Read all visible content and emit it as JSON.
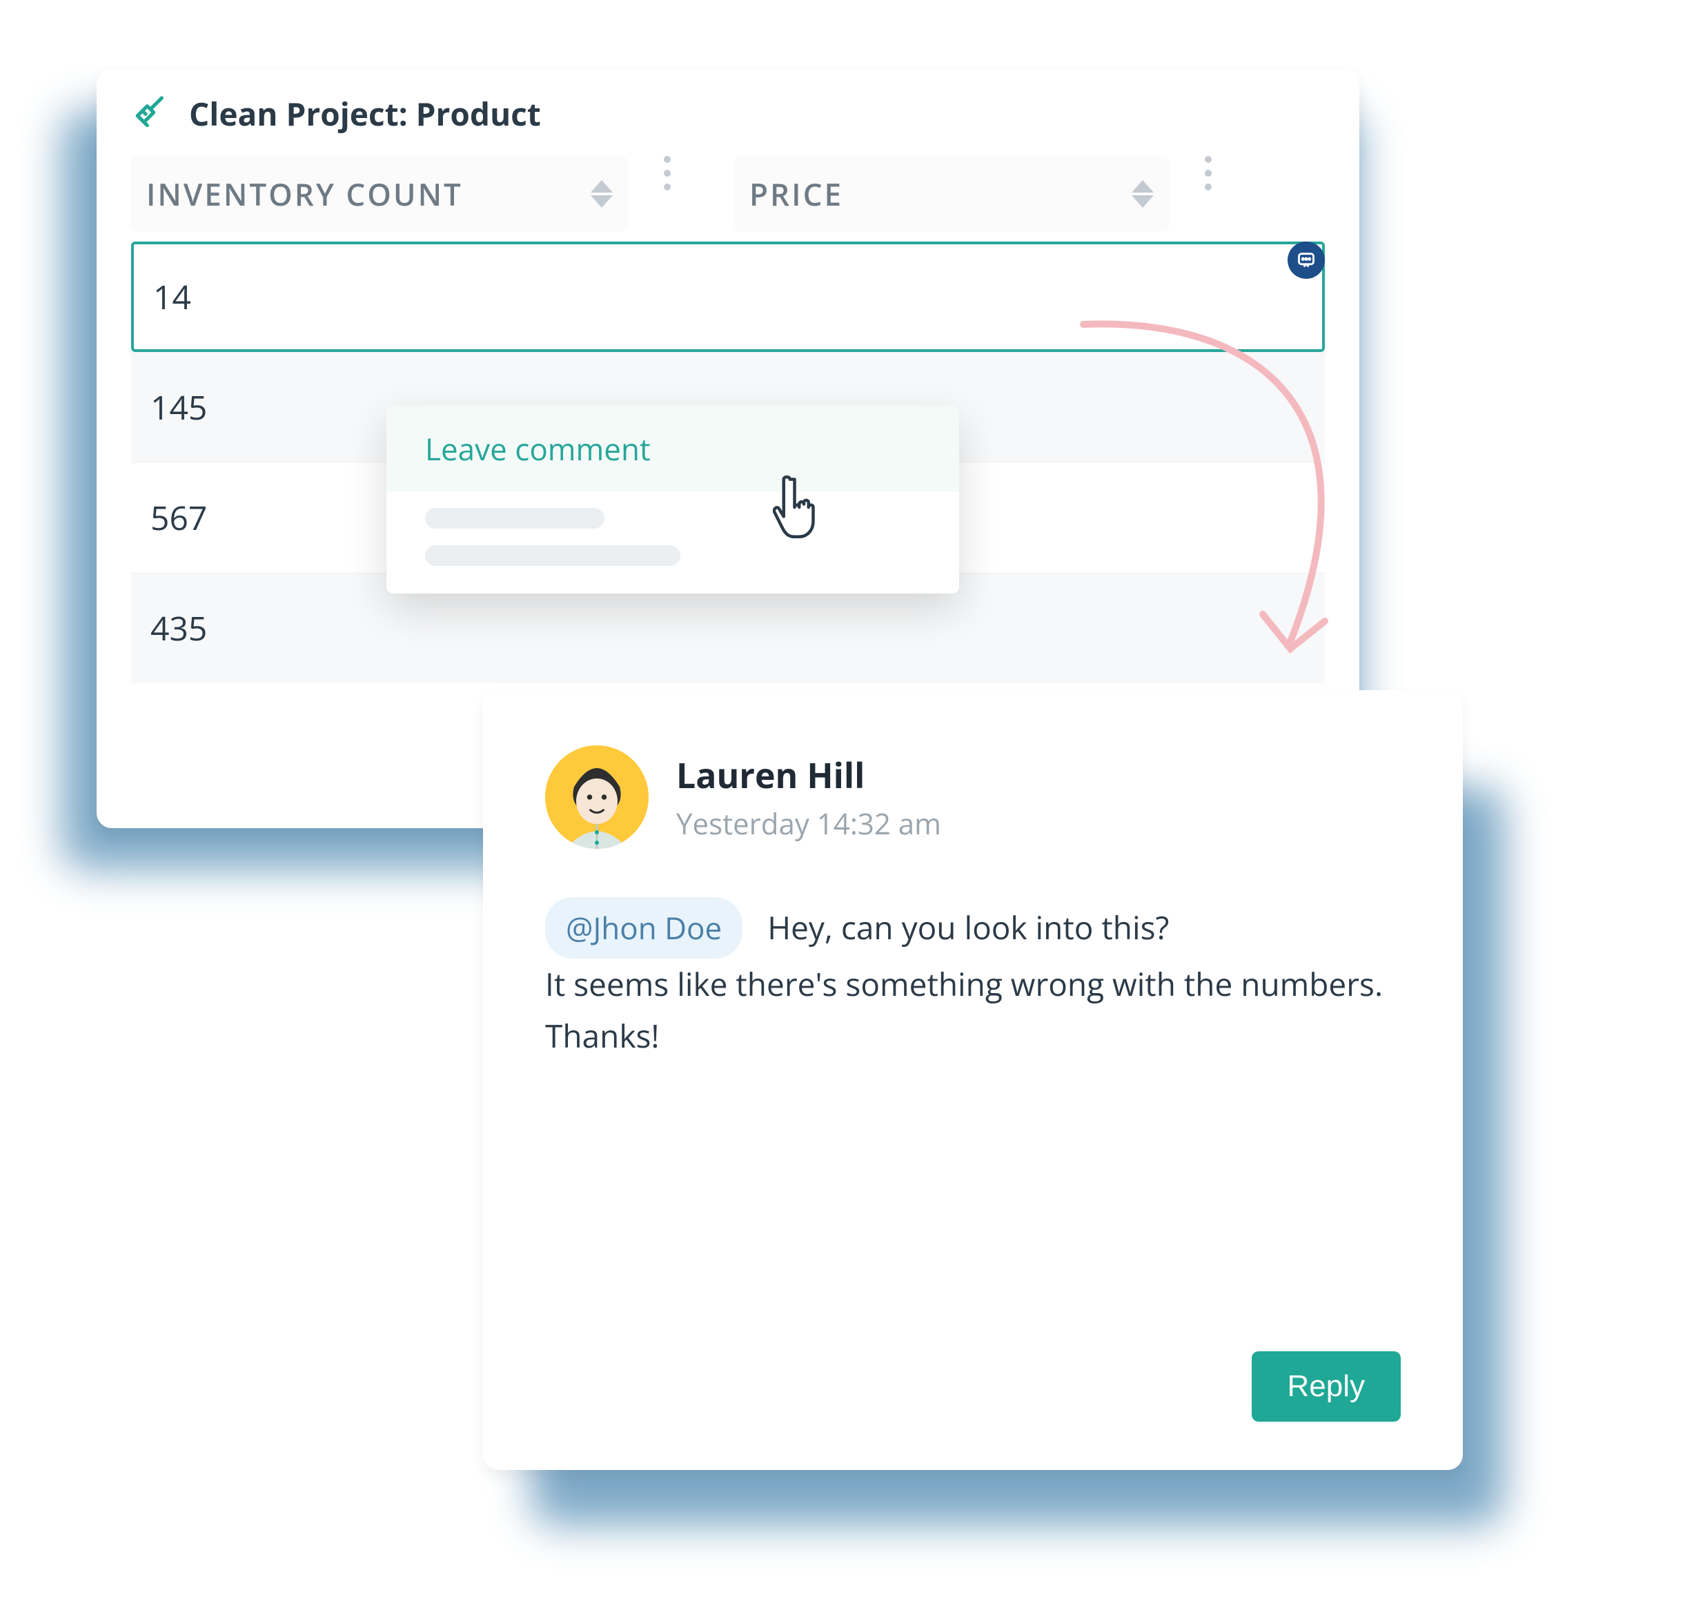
{
  "top": {
    "title": "Clean Project: Product",
    "columns": [
      {
        "label": "INVENTORY COUNT"
      },
      {
        "label": "PRICE"
      }
    ],
    "rows": [
      "14",
      "145",
      "567",
      "435"
    ]
  },
  "context_menu": {
    "leave_comment": "Leave comment"
  },
  "comment": {
    "author": "Lauren Hill",
    "timestamp": "Yesterday 14:32 am",
    "mention": "@Jhon Doe",
    "text_line1": "Hey, can you look into this?",
    "text_line2": "It seems like there's something wrong with the numbers.",
    "text_line3": "Thanks!",
    "reply_label": "Reply"
  }
}
